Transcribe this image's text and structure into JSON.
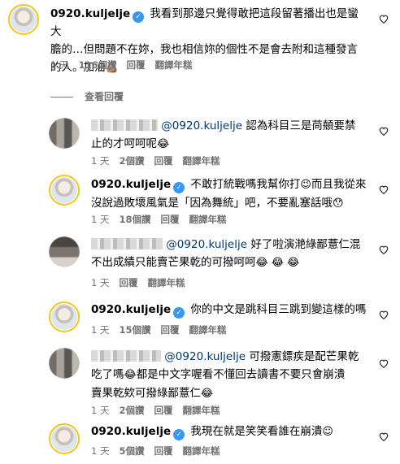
{
  "comments": [
    {
      "user": "0920.kuljelje",
      "lines": [
        "我看到那邊只覺得敢把這段留著播出也是蠻大",
        "膽的…但問題不在妳，我也相信妳的個性不是會去附和這種發言",
        "的人。加油"
      ],
      "emoji": "💪🏽",
      "time": "1 天",
      "likes": "116個讚",
      "reply": "回覆",
      "translate": "翻譯年糕"
    },
    {
      "user": "",
      "mention": "@0920.kuljelje",
      "lines": [
        "認為科目三是苘顤要禁",
        "止的才呵呵呢"
      ],
      "emoji": "😂",
      "time": "1 天",
      "likes": "2個讚",
      "reply": "回覆",
      "translate": "翻譯年糕"
    },
    {
      "user": "0920.kuljelje",
      "lines": [
        "不敢打統戰嗎我幫你打",
        "而且我從來",
        "沒說過敗壞風氣是「因為舞統」吧，不要亂塞話哦"
      ],
      "emoji1": "😉",
      "emoji2": "😯",
      "time": "1 天",
      "likes": "18個讚",
      "reply": "回覆",
      "translate": "翻譯年糕"
    },
    {
      "user": "",
      "mention": "@0920.kuljelje",
      "lines": [
        "好了啦演滟綠鄙薏仁混",
        "不出成績只能賣芒果乾的可撥呵呵"
      ],
      "emoji": "😂 😂 😂",
      "time": "1 天",
      "reply": "回覆",
      "translate": "翻譯年糕"
    },
    {
      "user": "0920.kuljelje",
      "lines": [
        "你的中文是跳科目三跳到變這樣的嗎"
      ],
      "time": "1 天",
      "likes": "15個讚",
      "reply": "回覆",
      "translate": "翻譯年糕"
    },
    {
      "user": "",
      "mention": "@0920.kuljelje",
      "lines": [
        "可撥憲鏢疾是配芒果乾",
        "吃了嗎",
        "都是中文字喔看不懂回去讀書不要只會崩潰",
        "賣果乾欸可撥綠鄙薏仁"
      ],
      "emoji1": "😂",
      "emoji2": "😂",
      "time": "1 天",
      "likes": "2個讚",
      "reply": "回覆",
      "translate": "翻譯年糕"
    },
    {
      "user": "0920.kuljelje",
      "lines": [
        "我現在就是笑笑看誰在崩潰"
      ],
      "emoji": "☺",
      "time": "1 天",
      "likes": "5個讚",
      "reply": "回覆",
      "translate": "翻譯年糕"
    }
  ],
  "view_replies": "查看回覆",
  "verified_icon": "check-badge-icon",
  "heart_icon": "heart-outline-icon"
}
